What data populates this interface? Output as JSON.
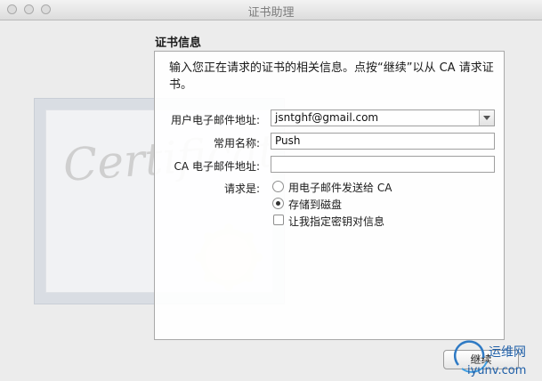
{
  "window": {
    "title": "证书助理"
  },
  "section_title": "证书信息",
  "intro": "输入您正在请求的证书的相关信息。点按“继续”以从 CA 请求证书。",
  "form": {
    "user_email_label": "用户电子邮件地址:",
    "user_email_value": "jsntghf@gmail.com",
    "common_name_label": "常用名称:",
    "common_name_value": "Push",
    "ca_email_label": "CA 电子邮件地址:",
    "ca_email_value": "",
    "request_label": "请求是:",
    "options": {
      "email_to_ca": "用电子邮件发送给 CA",
      "save_to_disk": "存储到磁盘",
      "specify_key": "让我指定密钥对信息"
    },
    "selected_option": "save_to_disk",
    "specify_key_checked": false
  },
  "buttons": {
    "continue": "继续"
  },
  "background": {
    "cert_script": "Certificate"
  },
  "watermark": {
    "brand": "运维网",
    "site": "iyunv.com"
  },
  "colors": {
    "window_bg": "#ececec",
    "panel_border": "#a9a9a9"
  },
  "icons": [
    "close-icon",
    "minimize-icon",
    "zoom-icon",
    "chevron-down-icon",
    "certificate-icon"
  ]
}
